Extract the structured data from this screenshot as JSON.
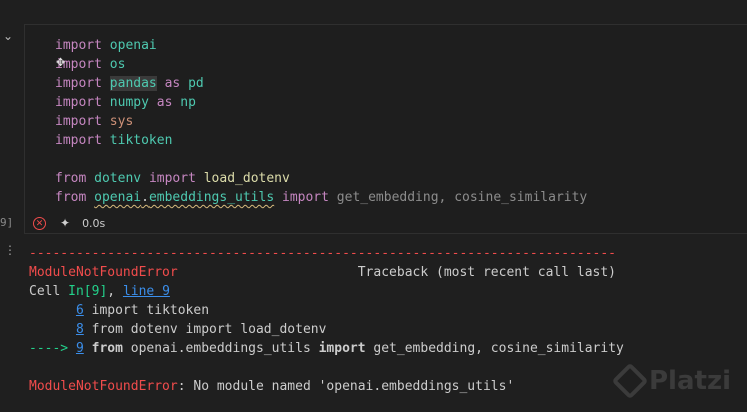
{
  "cell": {
    "exec_label": "9]",
    "code_lines": [
      [
        {
          "t": "import",
          "c": "kw"
        },
        {
          "t": " ",
          "c": "plain"
        },
        {
          "t": "openai",
          "c": "mod"
        }
      ],
      [
        {
          "t": "import",
          "c": "kw"
        },
        {
          "t": " ",
          "c": "plain"
        },
        {
          "t": "os",
          "c": "mod"
        }
      ],
      [
        {
          "t": "import",
          "c": "kw"
        },
        {
          "t": " ",
          "c": "plain"
        },
        {
          "t": "pandas",
          "c": "mod hl"
        },
        {
          "t": " ",
          "c": "plain"
        },
        {
          "t": "as",
          "c": "kw"
        },
        {
          "t": " ",
          "c": "plain"
        },
        {
          "t": "pd",
          "c": "mod"
        }
      ],
      [
        {
          "t": "import",
          "c": "kw"
        },
        {
          "t": " ",
          "c": "plain"
        },
        {
          "t": "numpy",
          "c": "mod"
        },
        {
          "t": " ",
          "c": "plain"
        },
        {
          "t": "as",
          "c": "kw"
        },
        {
          "t": " ",
          "c": "plain"
        },
        {
          "t": "np",
          "c": "mod"
        }
      ],
      [
        {
          "t": "import",
          "c": "kw"
        },
        {
          "t": " ",
          "c": "plain"
        },
        {
          "t": "sys",
          "c": "imp"
        }
      ],
      [
        {
          "t": "import",
          "c": "kw"
        },
        {
          "t": " ",
          "c": "plain"
        },
        {
          "t": "tiktoken",
          "c": "mod"
        }
      ],
      [
        {
          "t": "",
          "c": "plain"
        }
      ],
      [
        {
          "t": "from",
          "c": "kw"
        },
        {
          "t": " ",
          "c": "plain"
        },
        {
          "t": "dotenv",
          "c": "mod"
        },
        {
          "t": " ",
          "c": "plain"
        },
        {
          "t": "import",
          "c": "kw"
        },
        {
          "t": " ",
          "c": "plain"
        },
        {
          "t": "load_dotenv",
          "c": "fn"
        }
      ],
      [
        {
          "t": "from",
          "c": "kw"
        },
        {
          "t": " ",
          "c": "plain"
        },
        {
          "t": "openai",
          "c": "mod squiggle"
        },
        {
          "t": ".",
          "c": "plain squiggle"
        },
        {
          "t": "embeddings_utils",
          "c": "mod squiggle"
        },
        {
          "t": " ",
          "c": "plain"
        },
        {
          "t": "import",
          "c": "kw"
        },
        {
          "t": " get_embedding, cosine_similarity",
          "c": "dim"
        }
      ]
    ],
    "status": {
      "error_icon": "error-circle-icon",
      "sparkle_icon": "sparkle-icon",
      "duration": "0.0s"
    }
  },
  "output": {
    "lines": [
      [
        {
          "t": "---------------------------------------------------------------------------",
          "c": "red"
        }
      ],
      [
        {
          "t": "ModuleNotFoundError",
          "c": "red"
        },
        {
          "t": "                       Traceback (most recent call last)",
          "c": "plain"
        }
      ],
      [
        {
          "t": "Cell ",
          "c": "plain"
        },
        {
          "t": "In[9]",
          "c": "green"
        },
        {
          "t": ", ",
          "c": "plain"
        },
        {
          "t": "line 9",
          "c": "link"
        }
      ],
      [
        {
          "t": "      ",
          "c": "plain"
        },
        {
          "t": "6",
          "c": "link"
        },
        {
          "t": " import tiktoken",
          "c": "plain"
        }
      ],
      [
        {
          "t": "      ",
          "c": "plain"
        },
        {
          "t": "8",
          "c": "link"
        },
        {
          "t": " from dotenv import load_dotenv",
          "c": "plain"
        }
      ],
      [
        {
          "t": "----> ",
          "c": "green"
        },
        {
          "t": "9",
          "c": "link"
        },
        {
          "t": " ",
          "c": "plain"
        },
        {
          "t": "from",
          "c": "plain bold"
        },
        {
          "t": " openai.embeddings_utils ",
          "c": "plain"
        },
        {
          "t": "import",
          "c": "plain bold"
        },
        {
          "t": " get_embedding, cosine_similarity",
          "c": "plain"
        }
      ],
      [
        {
          "t": "",
          "c": "plain"
        }
      ],
      [
        {
          "t": "ModuleNotFoundError",
          "c": "red"
        },
        {
          "t": ": No module named 'openai.embeddings_utils'",
          "c": "plain"
        }
      ]
    ]
  },
  "watermark": {
    "text": "Platzi"
  }
}
